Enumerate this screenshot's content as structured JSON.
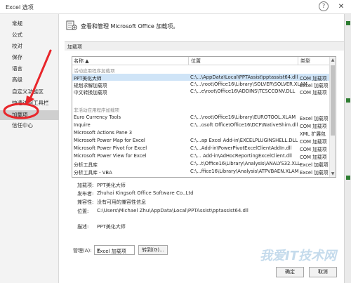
{
  "window": {
    "title": "Excel 选项",
    "help": "?",
    "close": "✕"
  },
  "sidebar": {
    "items": [
      {
        "label": "常规"
      },
      {
        "label": "公式"
      },
      {
        "label": "校对"
      },
      {
        "label": "保存"
      },
      {
        "label": "语言"
      },
      {
        "label": "高级"
      },
      {
        "label": "自定义功能区"
      },
      {
        "label": "快速访问工具栏"
      },
      {
        "label": "加载项"
      },
      {
        "label": "信任中心"
      }
    ],
    "selected_index": 8
  },
  "header": {
    "text": "查看和管理 Microsoft Office 加载项。"
  },
  "section": {
    "label": "加载项"
  },
  "table": {
    "headers": {
      "name": "名称 ▲",
      "location": "位置",
      "type": "类型"
    },
    "group_active": "活动应用程序加载项",
    "group_inactive": "非活动应用程序加载项",
    "active_rows": [
      {
        "name": "PPT美化大师",
        "location": "C:\\...\\AppData\\Local\\PPTAssist\\pptassist64.dll",
        "type": "COM 加载项"
      },
      {
        "name": "规划求解加载项",
        "location": "C:\\...\\root\\Office16\\Library\\SOLVER\\SOLVER.XLAM",
        "type": "Excel 加载项"
      },
      {
        "name": "中文转换加载项",
        "location": "C:\\...e\\root\\Office16\\ADDINS\\TCSCCONV.DLL",
        "type": "COM 加载项"
      }
    ],
    "inactive_rows": [
      {
        "name": "Euro Currency Tools",
        "location": "C:\\...\\root\\Office16\\Library\\EUROTOOL.XLAM",
        "type": "Excel 加载项"
      },
      {
        "name": "Inquire",
        "location": "C:\\...osoft Office\\Office16\\DCF\\NativeShim.dll",
        "type": "COM 加载项"
      },
      {
        "name": "Microsoft Actions Pane 3",
        "location": "",
        "type": "XML 扩展包"
      },
      {
        "name": "Microsoft Power Map for Excel",
        "location": "C:\\...ap Excel Add-in\\EXCELPLUGINSHELL.DLL",
        "type": "COM 加载项"
      },
      {
        "name": "Microsoft Power Pivot for Excel",
        "location": "C:\\...Add-in\\PowerPivotExcelClientAddIn.dll",
        "type": "COM 加载项"
      },
      {
        "name": "Microsoft Power View for Excel",
        "location": "C:\\... Add-in\\AdHocReportingExcelClient.dll",
        "type": "COM 加载项"
      },
      {
        "name": "分析工具库",
        "location": "C:\\...t\\Office16\\Library\\Analysis\\ANALYS32.XLL",
        "type": "Excel 加载项"
      },
      {
        "name": "分析工具库 - VBA",
        "location": "C:\\...ffice16\\Library\\Analysis\\ATPVBAEN.XLAM",
        "type": "Excel 加载项"
      }
    ]
  },
  "details": {
    "addin_label": "加载项:",
    "addin_value": "PPT美化大师",
    "publisher_label": "发布者:",
    "publisher_value": "Zhuhai Kingsoft Office Software Co.,Ltd",
    "compat_label": "兼容性:",
    "compat_value": "没有可用的兼容性信息",
    "location_label": "位置:",
    "location_value": "C:\\Users\\Michael Zhu\\AppData\\Local\\PPTAssist\\pptassist64.dll",
    "desc_label": "描述:",
    "desc_value": "PPT美化大师"
  },
  "manage": {
    "label": "管理(A):",
    "selected": "Excel 加载项",
    "go_button": "转到(G)..."
  },
  "footer": {
    "ok": "确定",
    "cancel": "取消"
  },
  "watermark": "我爱IT技术网",
  "colors": {
    "selection": "#cfe4f7",
    "annotation": "#e8262b"
  }
}
